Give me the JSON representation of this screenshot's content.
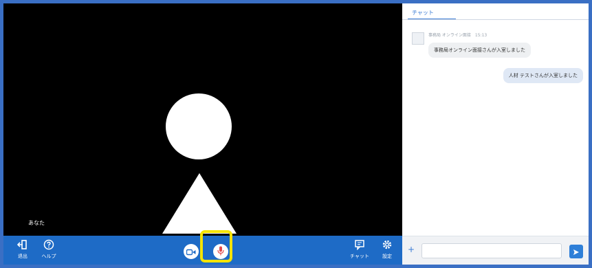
{
  "video": {
    "self_label": "あなた"
  },
  "toolbar": {
    "leave_label": "退出",
    "help_label": "ヘルプ",
    "chat_label": "チャット",
    "settings_label": "設定"
  },
  "chat": {
    "tab_label": "チャット",
    "messages": [
      {
        "sender_meta": "事務局 オンライン面接　15:13",
        "text": "事務局オンライン面接さんが入室しました"
      },
      {
        "text": "人材 テストさんが入室しました"
      }
    ],
    "input_placeholder": ""
  },
  "colors": {
    "toolbar_bg": "#1e6bc6",
    "highlight": "#f5e300",
    "mic_icon": "#e24b4b",
    "accent": "#3a7bd5"
  }
}
